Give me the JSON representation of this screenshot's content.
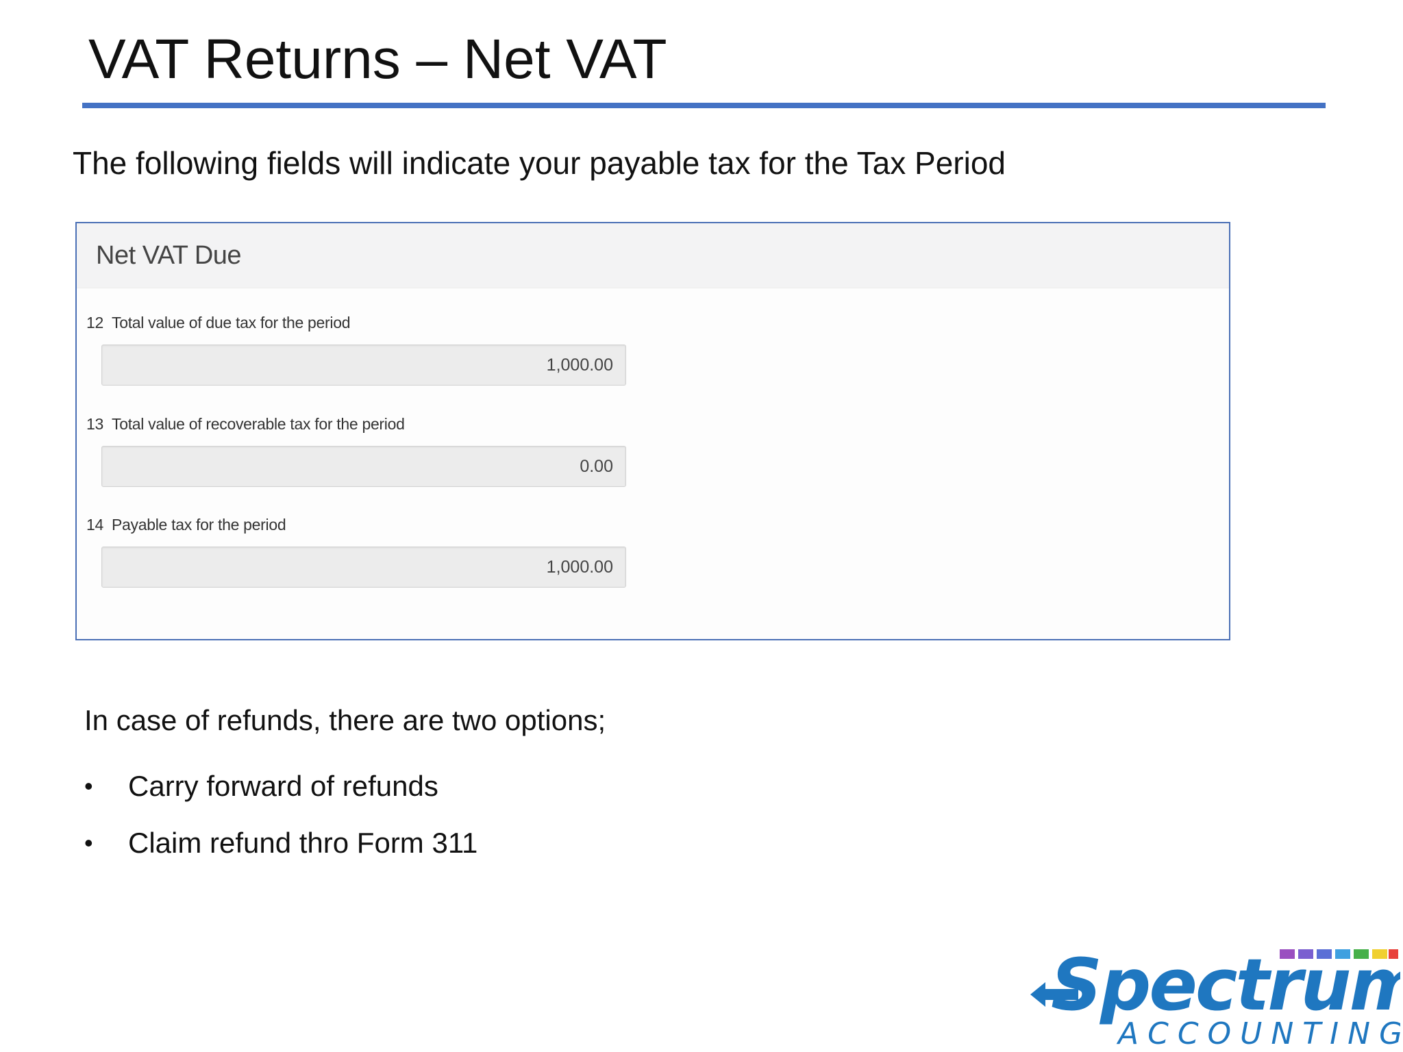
{
  "slide": {
    "title": "VAT Returns – Net VAT",
    "intro": "The following fields will indicate your payable tax for the Tax Period"
  },
  "panel": {
    "title": "Net VAT Due",
    "fields": [
      {
        "number": "12",
        "label": "Total value of due tax for the period",
        "value": "1,000.00"
      },
      {
        "number": "13",
        "label": "Total value of recoverable tax for the period",
        "value": "0.00"
      },
      {
        "number": "14",
        "label": "Payable tax for the period",
        "value": "1,000.00"
      }
    ]
  },
  "refunds": {
    "intro": "In case of refunds, there are two options;",
    "options": [
      "Carry forward of refunds",
      "Claim refund thro Form 311"
    ]
  },
  "logo": {
    "name": "Spectrum",
    "tagline": "ACCOUNTING",
    "brand_color": "#1f77c0",
    "stripe_colors": [
      "#9a4fc0",
      "#5b6fd6",
      "#3fa0e0",
      "#46b04a",
      "#f0d030",
      "#f08a20",
      "#e8413a"
    ]
  },
  "colors": {
    "title_rule": "#4472c4",
    "panel_border": "#4a6fb5"
  }
}
